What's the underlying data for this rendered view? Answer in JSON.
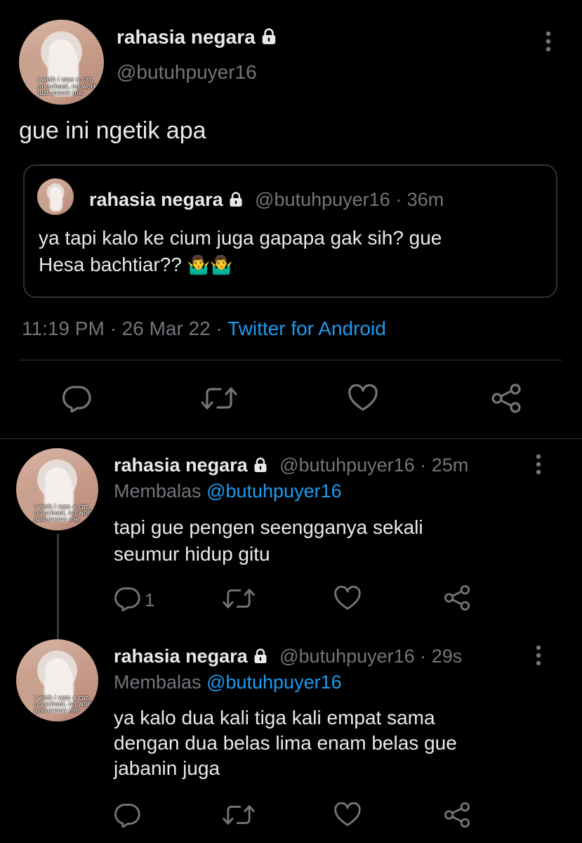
{
  "main_tweet": {
    "name": "rahasia negara",
    "handle": "@butuhpuyer16",
    "text": "gue ini ngetik apa",
    "avatar_caption": [
      "i wish i was a cat,",
      "no school, no work,",
      "just meow me"
    ],
    "quoted": {
      "name": "rahasia negara",
      "handle": "@butuhpuyer16",
      "sep": "·",
      "time": "36m",
      "text_line1": "ya tapi kalo ke cium juga gapapa gak sih? gue",
      "text_line2": "Hesa bachtiar??",
      "emoji": "🤷‍♂️🤷‍♂️"
    },
    "time": "11:19 PM",
    "date": "26 Mar 22",
    "sep": "·",
    "source": "Twitter for Android"
  },
  "replies": [
    {
      "name": "rahasia negara",
      "handle": "@butuhpuyer16",
      "sep": "·",
      "time": "25m",
      "replying_label": "Membalas",
      "replying_to": "@butuhpuyer16",
      "line1": "tapi gue pengen seengganya sekali",
      "line2": "seumur hidup gitu",
      "line3": "",
      "reply_count": "1"
    },
    {
      "name": "rahasia negara",
      "handle": "@butuhpuyer16",
      "sep": "·",
      "time": "29s",
      "replying_label": "Membalas",
      "replying_to": "@butuhpuyer16",
      "line1": "ya kalo dua kali tiga kali empat sama",
      "line2": "dengan dua belas lima enam belas gue",
      "line3": "jabanin juga",
      "reply_count": ""
    }
  ],
  "colors": {
    "background": "#000000",
    "text": "#e7e9ea",
    "secondary": "#71767b",
    "link": "#1d9bf0",
    "border": "#2f3336"
  },
  "icons": [
    "lock-icon",
    "more-icon",
    "reply-icon",
    "retweet-icon",
    "like-icon",
    "share-icon"
  ]
}
